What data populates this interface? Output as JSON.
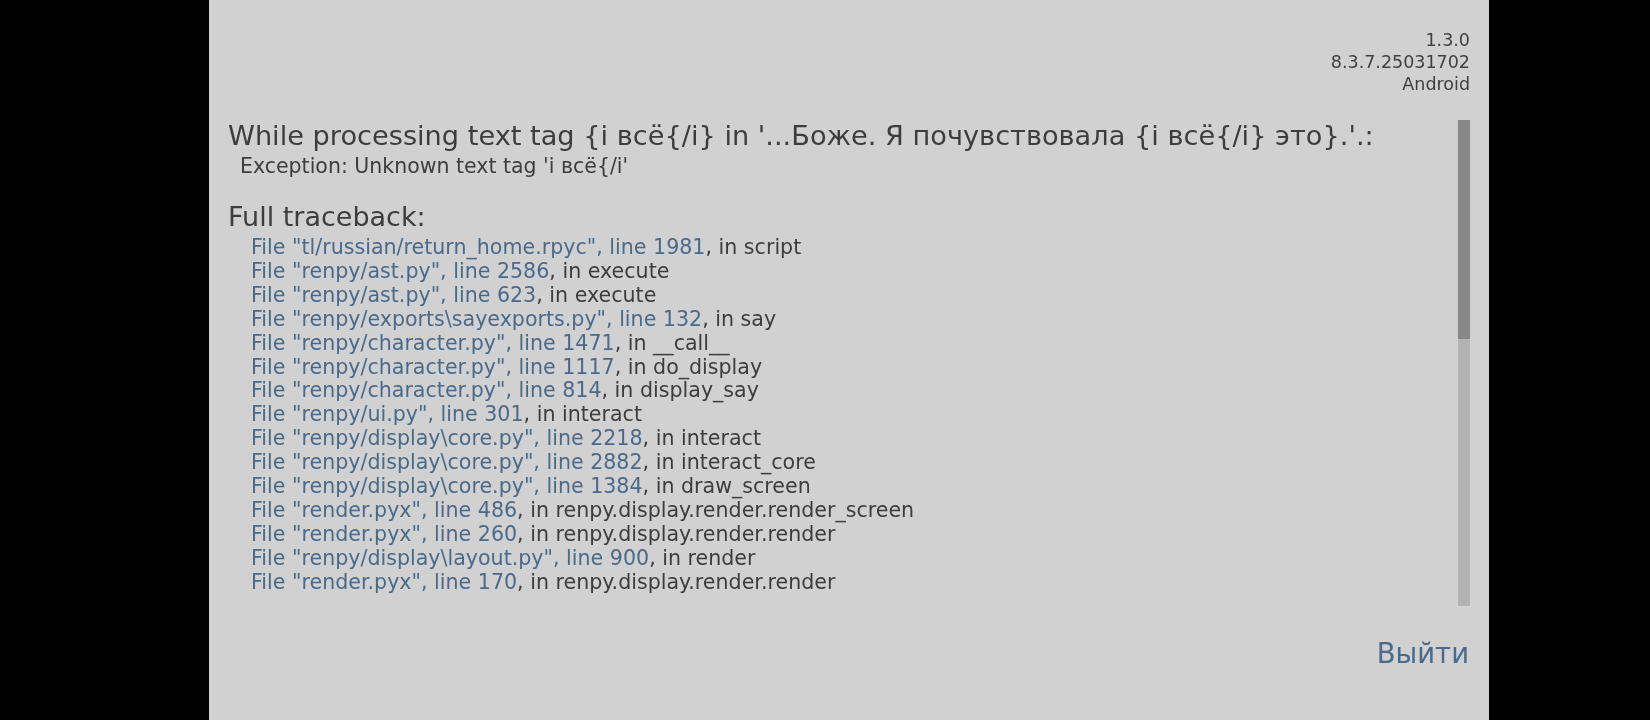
{
  "versions": [
    "1.3.0",
    "8.3.7.25031702",
    "Android"
  ],
  "error": {
    "title": "While processing text tag {i всё{/i} in '...Боже. Я почувствовала {i всё{/i} это}.'.:",
    "exception": "Exception: Unknown text tag 'i всё{/i'"
  },
  "traceback": {
    "heading": "Full traceback:",
    "frames": [
      {
        "location": "File \"tl/russian/return_home.rpyc\", line 1981",
        "context": ", in script"
      },
      {
        "location": "File \"renpy/ast.py\", line 2586",
        "context": ", in execute"
      },
      {
        "location": "File \"renpy/ast.py\", line 623",
        "context": ", in execute"
      },
      {
        "location": "File \"renpy/exports\\sayexports.py\", line 132",
        "context": ", in say"
      },
      {
        "location": "File \"renpy/character.py\", line 1471",
        "context": ", in __call__"
      },
      {
        "location": "File \"renpy/character.py\", line 1117",
        "context": ", in do_display"
      },
      {
        "location": "File \"renpy/character.py\", line 814",
        "context": ", in display_say"
      },
      {
        "location": "File \"renpy/ui.py\", line 301",
        "context": ", in interact"
      },
      {
        "location": "File \"renpy/display\\core.py\", line 2218",
        "context": ", in interact"
      },
      {
        "location": "File \"renpy/display\\core.py\", line 2882",
        "context": ", in interact_core"
      },
      {
        "location": "File \"renpy/display\\core.py\", line 1384",
        "context": ", in draw_screen"
      },
      {
        "location": "File \"render.pyx\", line 486",
        "context": ", in renpy.display.render.render_screen"
      },
      {
        "location": "File \"render.pyx\", line 260",
        "context": ", in renpy.display.render.render"
      },
      {
        "location": "File \"renpy/display\\layout.py\", line 900",
        "context": ", in render"
      },
      {
        "location": "File \"render.pyx\", line 170",
        "context": ", in renpy.display.render.render"
      }
    ]
  },
  "buttons": [
    {
      "label": "Выйти"
    }
  ]
}
